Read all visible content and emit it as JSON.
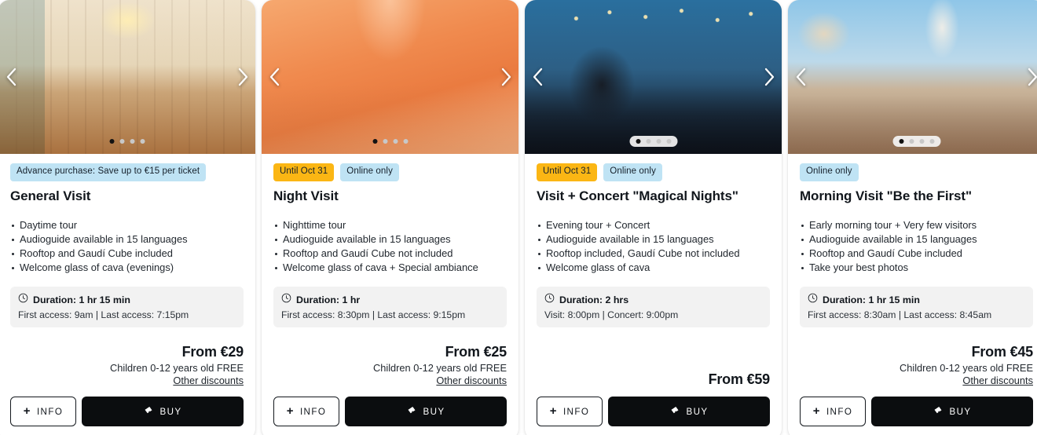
{
  "cards": [
    {
      "id": "general-visit",
      "badges": [
        {
          "text": "Advance purchase: Save up to €15 per ticket",
          "style": "blue"
        }
      ],
      "title": "General Visit",
      "features": [
        "Daytime tour",
        "Audioguide available in 15 languages",
        "Rooftop and Gaudí Cube included",
        "Welcome glass of cava (evenings)"
      ],
      "duration_label": "Duration: 1 hr 15 min",
      "duration_sub": "First access: 9am | Last access: 7:15pm",
      "price": "From €29",
      "children": "Children 0-12 years old FREE",
      "discounts": "Other discounts",
      "info_label": "INFO",
      "buy_label": "BUY",
      "slides": 4,
      "active_slide": 0,
      "dots_plated": false
    },
    {
      "id": "night-visit",
      "badges": [
        {
          "text": "Until Oct 31",
          "style": "amber"
        },
        {
          "text": "Online only",
          "style": "blue"
        }
      ],
      "title": "Night Visit",
      "features": [
        "Nighttime tour",
        "Audioguide available in 15 languages",
        "Rooftop and Gaudí Cube not included",
        "Welcome glass of cava + Special ambiance"
      ],
      "duration_label": "Duration: 1 hr",
      "duration_sub": "First access: 8:30pm | Last access: 9:15pm",
      "price": "From €25",
      "children": "Children 0-12 years old FREE",
      "discounts": "Other discounts",
      "info_label": "INFO",
      "buy_label": "BUY",
      "slides": 4,
      "active_slide": 0,
      "dots_plated": false
    },
    {
      "id": "visit-concert-magical-nights",
      "badges": [
        {
          "text": "Until Oct 31",
          "style": "amber"
        },
        {
          "text": "Online only",
          "style": "blue"
        }
      ],
      "title": "Visit + Concert \"Magical Nights\"",
      "features": [
        "Evening tour + Concert",
        "Audioguide available in 15 languages",
        "Rooftop included, Gaudí Cube not included",
        "Welcome glass of cava"
      ],
      "duration_label": "Duration: 2 hrs",
      "duration_sub": "Visit: 8:00pm | Concert: 9:00pm",
      "price": "From €59",
      "children": "",
      "discounts": "",
      "info_label": "INFO",
      "buy_label": "BUY",
      "slides": 4,
      "active_slide": 0,
      "dots_plated": true
    },
    {
      "id": "morning-visit-be-the-first",
      "badges": [
        {
          "text": "Online only",
          "style": "blue"
        }
      ],
      "title": "Morning Visit \"Be the First\"",
      "features": [
        "Early morning tour + Very few visitors",
        "Audioguide available in 15 languages",
        "Rooftop and Gaudí Cube included",
        "Take your best photos"
      ],
      "duration_label": "Duration: 1 hr 15 min",
      "duration_sub": "First access: 8:30am | Last access: 8:45am",
      "price": "From €45",
      "children": "Children 0-12 years old FREE",
      "discounts": "Other discounts",
      "info_label": "INFO",
      "buy_label": "BUY",
      "slides": 4,
      "active_slide": 0,
      "dots_plated": true
    }
  ],
  "icons": {
    "prev": "chevron-left-icon",
    "next": "chevron-right-icon",
    "clock": "clock-icon",
    "ticket": "ticket-icon",
    "plus": "plus-icon"
  },
  "colors": {
    "badge_blue": "#bfe3f4",
    "badge_amber": "#fbb614",
    "buy_button": "#0b0d0f",
    "duration_bg": "#f2f2f2",
    "text": "#11161c"
  }
}
